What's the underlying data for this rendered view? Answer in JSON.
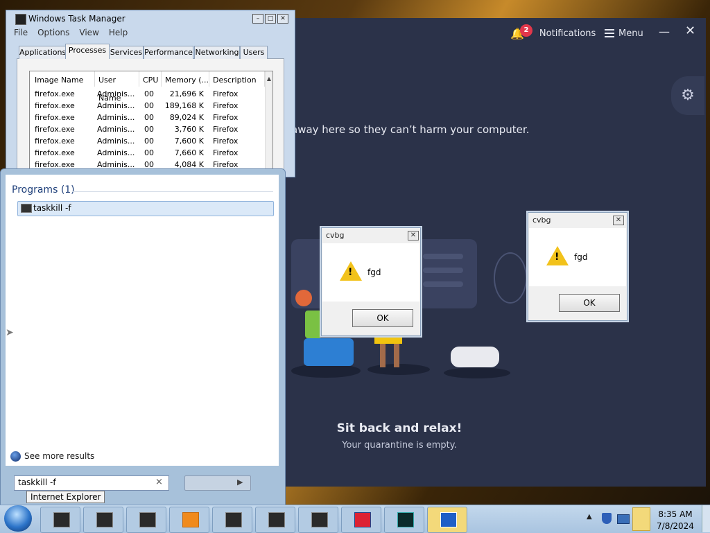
{
  "avast": {
    "notifications_label": "Notifications",
    "notifications_count": "2",
    "menu_label": "Menu",
    "quarantine_text": "away here so they can’t harm your computer.",
    "relax_heading": "Sit back and relax!",
    "empty_text": "Your quarantine is empty."
  },
  "task_manager": {
    "title": "Windows Task Manager",
    "menus": [
      "File",
      "Options",
      "View",
      "Help"
    ],
    "tabs": [
      "Applications",
      "Processes",
      "Services",
      "Performance",
      "Networking",
      "Users"
    ],
    "active_tab": "Processes",
    "columns": [
      "Image Name",
      "User Name",
      "CPU",
      "Memory (...",
      "Description"
    ],
    "rows": [
      {
        "image": "firefox.exe",
        "user": "Adminis...",
        "cpu": "00",
        "mem": "21,696 K",
        "desc": "Firefox"
      },
      {
        "image": "firefox.exe",
        "user": "Adminis...",
        "cpu": "00",
        "mem": "189,168 K",
        "desc": "Firefox"
      },
      {
        "image": "firefox.exe",
        "user": "Adminis...",
        "cpu": "00",
        "mem": "89,024 K",
        "desc": "Firefox"
      },
      {
        "image": "firefox.exe",
        "user": "Adminis...",
        "cpu": "00",
        "mem": "3,760 K",
        "desc": "Firefox"
      },
      {
        "image": "firefox.exe",
        "user": "Adminis...",
        "cpu": "00",
        "mem": "7,600 K",
        "desc": "Firefox"
      },
      {
        "image": "firefox.exe",
        "user": "Adminis...",
        "cpu": "00",
        "mem": "7,660 K",
        "desc": "Firefox"
      },
      {
        "image": "firefox.exe",
        "user": "Adminis...",
        "cpu": "00",
        "mem": "4,084 K",
        "desc": "Firefox"
      }
    ]
  },
  "start_menu": {
    "programs_header": "Programs (1)",
    "program_item": "taskkill -f",
    "see_more": "See more results",
    "search_value": "taskkill -f",
    "tooltip": "Internet Explorer"
  },
  "dialogs": [
    {
      "title": "cvbg",
      "message": "fgd",
      "ok_label": "OK"
    },
    {
      "title": "cvbg",
      "message": "fgd",
      "ok_label": "OK"
    }
  ],
  "taskbar": {
    "time": "8:35 AM",
    "date": "7/8/2024"
  },
  "colors": {
    "avast_bg": "#2b3249",
    "badge": "#e2374b",
    "taskbar": "#b5cde6"
  }
}
